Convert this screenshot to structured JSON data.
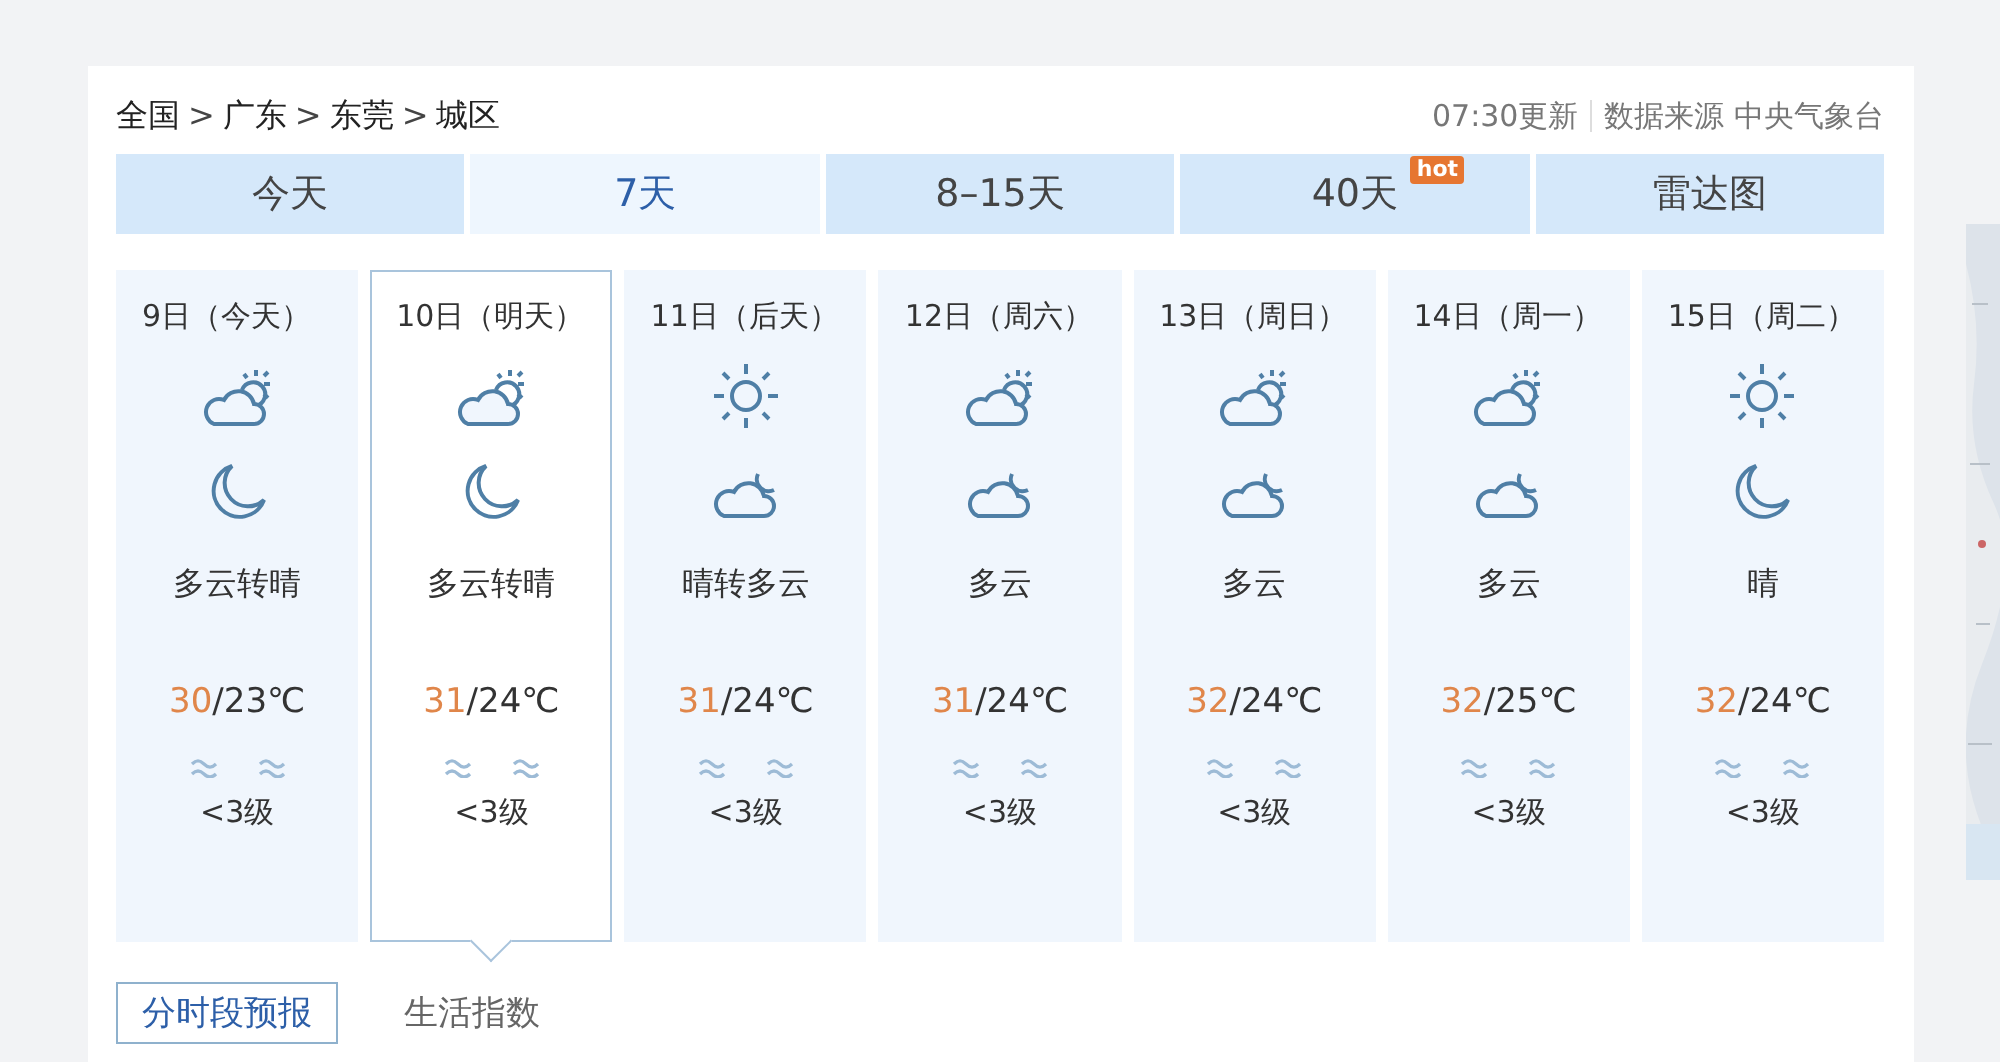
{
  "breadcrumb": [
    "全国",
    "广东",
    "东莞",
    "城区"
  ],
  "breadcrumb_separator": ">",
  "update_time": "07:30更新",
  "source": "数据来源 中央气象台",
  "tabs": [
    {
      "label": "今天",
      "selected": false
    },
    {
      "label": "7天",
      "selected": true
    },
    {
      "label": "8–15天",
      "selected": false
    },
    {
      "label": "40天",
      "selected": false,
      "badge": "hot"
    },
    {
      "label": "雷达图",
      "selected": false
    }
  ],
  "days": [
    {
      "date": "9日（今天）",
      "selected": false,
      "day_icon": {
        "kind": "partly-cloudy"
      },
      "night_icon": {
        "kind": "moon"
      },
      "weather": "多云转晴",
      "high": "30",
      "low": "/23℃",
      "wind": "<3级"
    },
    {
      "date": "10日（明天）",
      "selected": true,
      "day_icon": {
        "kind": "partly-cloudy"
      },
      "night_icon": {
        "kind": "moon"
      },
      "weather": "多云转晴",
      "high": "31",
      "low": "/24℃",
      "wind": "<3级"
    },
    {
      "date": "11日（后天）",
      "selected": false,
      "day_icon": {
        "kind": "sunny"
      },
      "night_icon": {
        "kind": "cloudy-night"
      },
      "weather": "晴转多云",
      "high": "31",
      "low": "/24℃",
      "wind": "<3级"
    },
    {
      "date": "12日（周六）",
      "selected": false,
      "day_icon": {
        "kind": "partly-cloudy"
      },
      "night_icon": {
        "kind": "cloudy-night"
      },
      "weather": "多云",
      "high": "31",
      "low": "/24℃",
      "wind": "<3级"
    },
    {
      "date": "13日（周日）",
      "selected": false,
      "day_icon": {
        "kind": "partly-cloudy"
      },
      "night_icon": {
        "kind": "cloudy-night"
      },
      "weather": "多云",
      "high": "32",
      "low": "/24℃",
      "wind": "<3级"
    },
    {
      "date": "14日（周一）",
      "selected": false,
      "day_icon": {
        "kind": "partly-cloudy"
      },
      "night_icon": {
        "kind": "cloudy-night"
      },
      "weather": "多云",
      "high": "32",
      "low": "/25℃",
      "wind": "<3级"
    },
    {
      "date": "15日（周二）",
      "selected": false,
      "day_icon": {
        "kind": "sunny"
      },
      "night_icon": {
        "kind": "moon"
      },
      "weather": "晴",
      "high": "32",
      "low": "/24℃",
      "wind": "<3级"
    }
  ],
  "sub_tabs": [
    {
      "label": "分时段预报",
      "selected": true
    },
    {
      "label": "生活指数",
      "selected": false
    }
  ],
  "side_panel": {
    "kind": "picture"
  }
}
